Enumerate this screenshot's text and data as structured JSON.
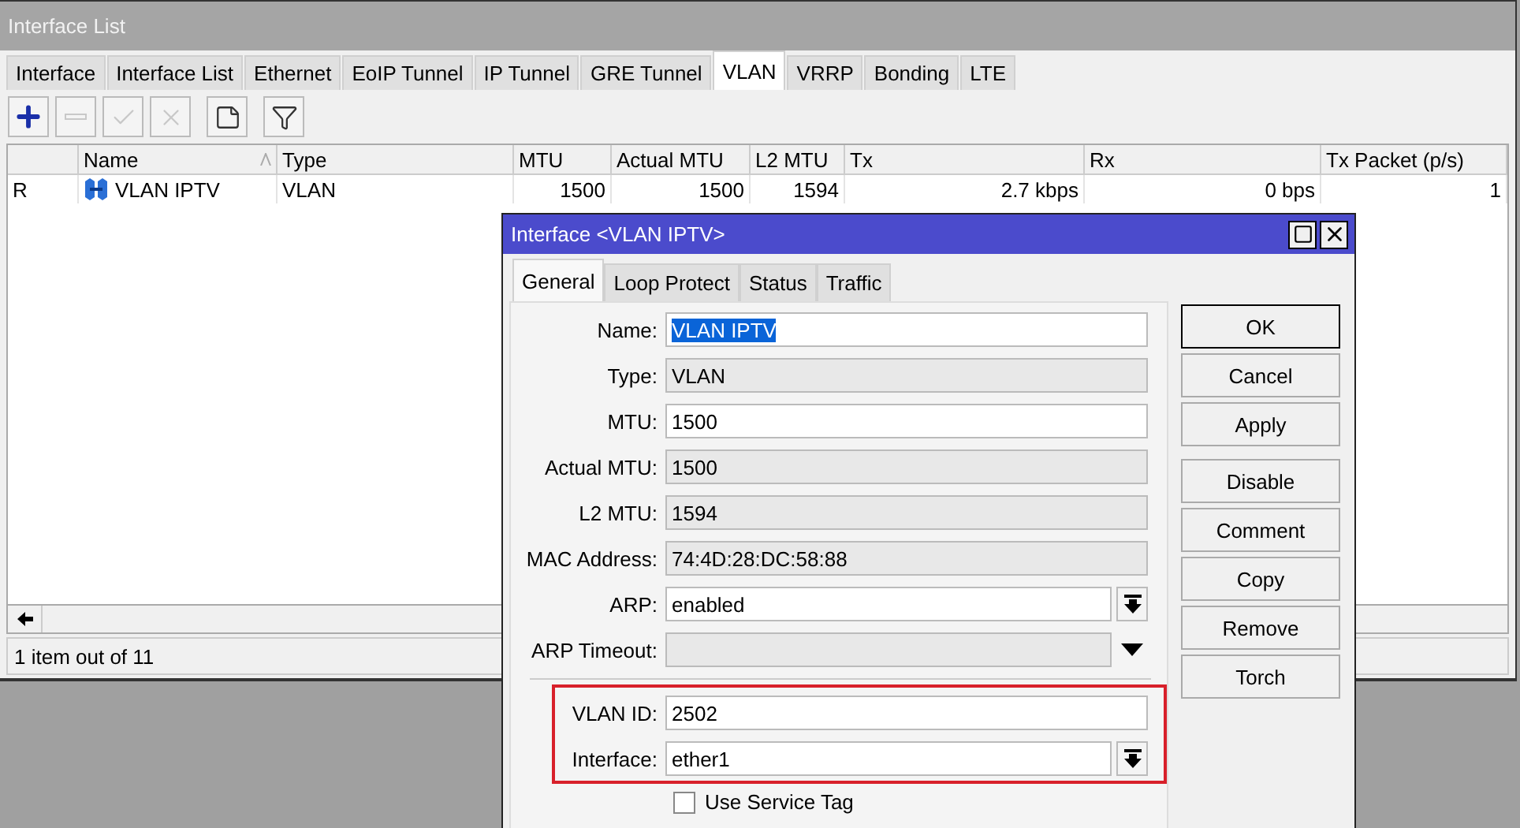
{
  "window": {
    "title": "Interface List"
  },
  "tabs": [
    {
      "label": "Interface",
      "selected": false
    },
    {
      "label": "Interface List",
      "selected": false
    },
    {
      "label": "Ethernet",
      "selected": false
    },
    {
      "label": "EoIP Tunnel",
      "selected": false
    },
    {
      "label": "IP Tunnel",
      "selected": false
    },
    {
      "label": "GRE Tunnel",
      "selected": false
    },
    {
      "label": "VLAN",
      "selected": true
    },
    {
      "label": "VRRP",
      "selected": false
    },
    {
      "label": "Bonding",
      "selected": false
    },
    {
      "label": "LTE",
      "selected": false
    }
  ],
  "toolbar": [
    {
      "kind": "add",
      "disabled": false
    },
    {
      "kind": "remove",
      "disabled": true
    },
    {
      "kind": "enable",
      "disabled": true
    },
    {
      "kind": "disable",
      "disabled": true
    },
    {
      "kind": "comment",
      "disabled": false
    },
    {
      "kind": "filter",
      "disabled": false
    }
  ],
  "table": {
    "columns": [
      {
        "label": "Name",
        "sorted": true
      },
      {
        "label": "Type"
      },
      {
        "label": "MTU"
      },
      {
        "label": "Actual MTU"
      },
      {
        "label": "L2 MTU"
      },
      {
        "label": "Tx"
      },
      {
        "label": "Rx"
      },
      {
        "label": "Tx Packet (p/s)"
      }
    ],
    "rows": [
      {
        "flag": "R",
        "cells": [
          "VLAN IPTV",
          "VLAN",
          "1500",
          "1500",
          "1594",
          "2.7 kbps",
          "0 bps",
          "1"
        ]
      }
    ]
  },
  "status_bar": "1 item out of 11",
  "dialog": {
    "title": "Interface <VLAN IPTV>",
    "tabs": [
      {
        "label": "General",
        "selected": true
      },
      {
        "label": "Loop Protect",
        "selected": false
      },
      {
        "label": "Status",
        "selected": false
      },
      {
        "label": "Traffic",
        "selected": false
      }
    ],
    "fields": [
      {
        "label": "Name:",
        "value": "VLAN IPTV",
        "kind": "text",
        "text_selected": true
      },
      {
        "label": "Type:",
        "value": "VLAN",
        "kind": "readonly"
      },
      {
        "label": "MTU:",
        "value": "1500",
        "kind": "text"
      },
      {
        "label": "Actual MTU:",
        "value": "1500",
        "kind": "readonly"
      },
      {
        "label": "L2 MTU:",
        "value": "1594",
        "kind": "readonly"
      },
      {
        "label": "MAC Address:",
        "value": "74:4D:28:DC:58:88",
        "kind": "readonly"
      },
      {
        "label": "ARP:",
        "value": "enabled",
        "kind": "dropdown"
      },
      {
        "label": "ARP Timeout:",
        "kind": "optional"
      }
    ],
    "highlighted_fields": [
      {
        "label": "VLAN ID:",
        "value": "2502",
        "kind": "text"
      },
      {
        "label": "Interface:",
        "value": "ether1",
        "kind": "dropdown"
      }
    ],
    "checkbox": {
      "label": "Use Service Tag",
      "checked": false
    },
    "buttons": [
      "OK",
      "Cancel",
      "Apply",
      "Disable",
      "Comment",
      "Copy",
      "Remove",
      "Torch"
    ]
  }
}
